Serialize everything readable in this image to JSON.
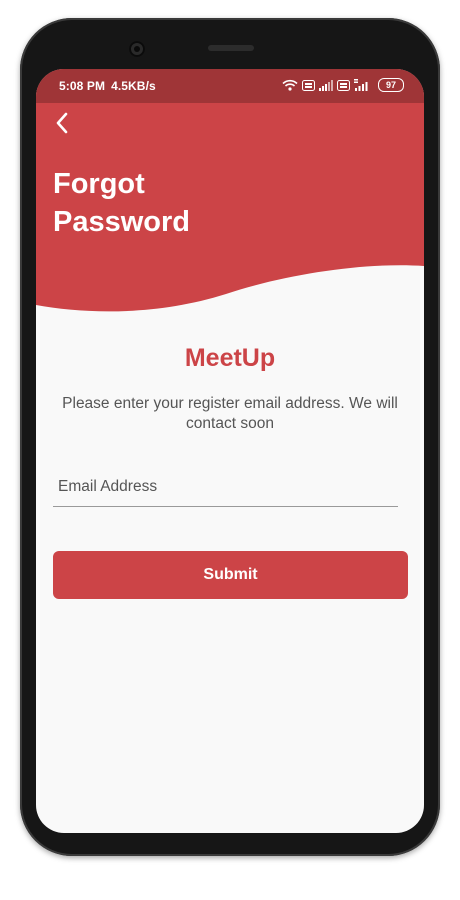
{
  "status_bar": {
    "time": "5:08 PM",
    "speed": "4.5KB/s",
    "battery": "97",
    "icons": [
      "wifi-icon",
      "volte-icon",
      "signal-icon",
      "volte-icon",
      "4g-signal-icon",
      "battery-icon"
    ]
  },
  "header": {
    "back_icon": "chevron-left-icon",
    "title": "Forgot Password"
  },
  "main": {
    "brand": "MeetUp",
    "subtitle": "Please enter your register email address. We will contact soon",
    "email": {
      "placeholder": "Email Address",
      "value": ""
    },
    "submit_label": "Submit"
  },
  "colors": {
    "accent": "#cc4447",
    "status_bar": "#9f3537",
    "background": "#f9f9f9",
    "phone_frame": "#161616"
  }
}
